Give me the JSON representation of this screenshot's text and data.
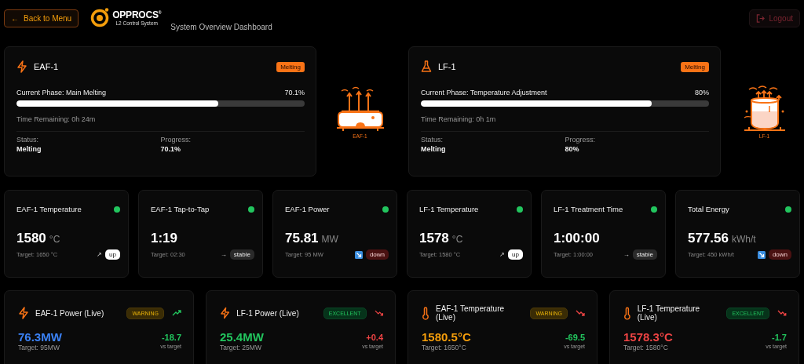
{
  "header": {
    "back_button": {
      "arrow": "←",
      "label": "Back to Menu"
    },
    "logo": {
      "name": "OPPROCS",
      "mark": "®",
      "tagline": "L2 Control System"
    },
    "subtitle": "System Overview Dashboard",
    "logout_button": {
      "label": "Logout"
    }
  },
  "furnaces": [
    {
      "kind": "eaf",
      "name": "EAF-1",
      "badge": "Melting",
      "phase": "Current Phase: Main Melting",
      "percent": "70.1%",
      "level": 0.701,
      "time_remaining": "Time Remaining: 0h 24m",
      "status_label": "Status:",
      "status_value": "Melting",
      "progress_label": "Progress:",
      "progress_value": "70.1%",
      "drawing_label": "EAF-1"
    },
    {
      "kind": "lf",
      "name": "LF-1",
      "badge": "Melting",
      "phase": "Current Phase: Temperature Adjustment",
      "percent": "80%",
      "level": 0.8,
      "time_remaining": "Time Remaining: 0h 1m",
      "status_label": "Status:",
      "status_value": "Melting",
      "progress_label": "Progress:",
      "progress_value": "80%",
      "drawing_label": "LF-1"
    }
  ],
  "metrics": [
    {
      "title": "EAF-1 Temperature",
      "color": "#22c55e",
      "value": "1580",
      "unit": "°C",
      "target": "Target: 1650 °C",
      "trend": {
        "kind": "up",
        "arrow": "↗",
        "label": "up"
      }
    },
    {
      "title": "EAF-1 Tap-to-Tap",
      "color": "#22c55e",
      "value": "1:19",
      "target": "Target: 02:30",
      "trend": {
        "kind": "stable",
        "arrow": "→",
        "label": "stable"
      }
    },
    {
      "title": "EAF-1 Power",
      "color": "#22c55e",
      "value": "75.81",
      "unit": "MW",
      "target": "Target: 95 MW",
      "trend": {
        "kind": "down",
        "label": "down"
      }
    },
    {
      "title": "LF-1 Temperature",
      "color": "#22c55e",
      "value": "1578",
      "unit": "°C",
      "target": "Target: 1580 °C",
      "trend": {
        "kind": "up",
        "arrow": "↗",
        "label": "up"
      }
    },
    {
      "title": "LF-1 Treatment Time",
      "color": "#22c55e",
      "value": "1:00:00",
      "target": "Target: 1:00:00",
      "trend": {
        "kind": "stable",
        "arrow": "→",
        "label": "stable"
      }
    },
    {
      "title": "Total Energy",
      "color": "#22c55e",
      "value": "577.56",
      "unit": "kWh/t",
      "target": "Target: 450 kWh/t",
      "trend": {
        "kind": "down",
        "label": "down"
      }
    }
  ],
  "live": [
    {
      "kind": "power",
      "title": "EAF-1 Power (Live)",
      "badge": {
        "kind": "warning",
        "label": "WARNING"
      },
      "trend": {
        "kind": "up"
      },
      "value": {
        "text": "76.3MW",
        "color": "#3b82f6"
      },
      "target": "Target: 95MW",
      "delta": {
        "text": "-18.7",
        "color": "#22c55e"
      },
      "delta_label": "vs target"
    },
    {
      "kind": "power",
      "title": "LF-1 Power (Live)",
      "badge": {
        "kind": "excellent",
        "label": "EXCELLENT"
      },
      "trend": {
        "kind": "down"
      },
      "value": {
        "text": "25.4MW",
        "color": "#22c55e"
      },
      "target": "Target: 25MW",
      "delta": {
        "text": "+0.4",
        "color": "#ef4444"
      },
      "delta_label": "vs target"
    },
    {
      "kind": "temperature",
      "title": "EAF-1 Temperature (Live)",
      "badge": {
        "kind": "warning",
        "label": "WARNING"
      },
      "trend": {
        "kind": "down"
      },
      "value": {
        "text": "1580.5°C",
        "color": "#f59e0b"
      },
      "target": "Target: 1650°C",
      "delta": {
        "text": "-69.5",
        "color": "#22c55e"
      },
      "delta_label": "vs target"
    },
    {
      "kind": "temperature",
      "title": "LF-1 Temperature (Live)",
      "badge": {
        "kind": "excellent",
        "label": "EXCELLENT"
      },
      "trend": {
        "kind": "down"
      },
      "value": {
        "text": "1578.3°C",
        "color": "#ef4444"
      },
      "target": "Target: 1580°C",
      "delta": {
        "text": "-1.7",
        "color": "#22c55e"
      },
      "delta_label": "vs target"
    }
  ]
}
